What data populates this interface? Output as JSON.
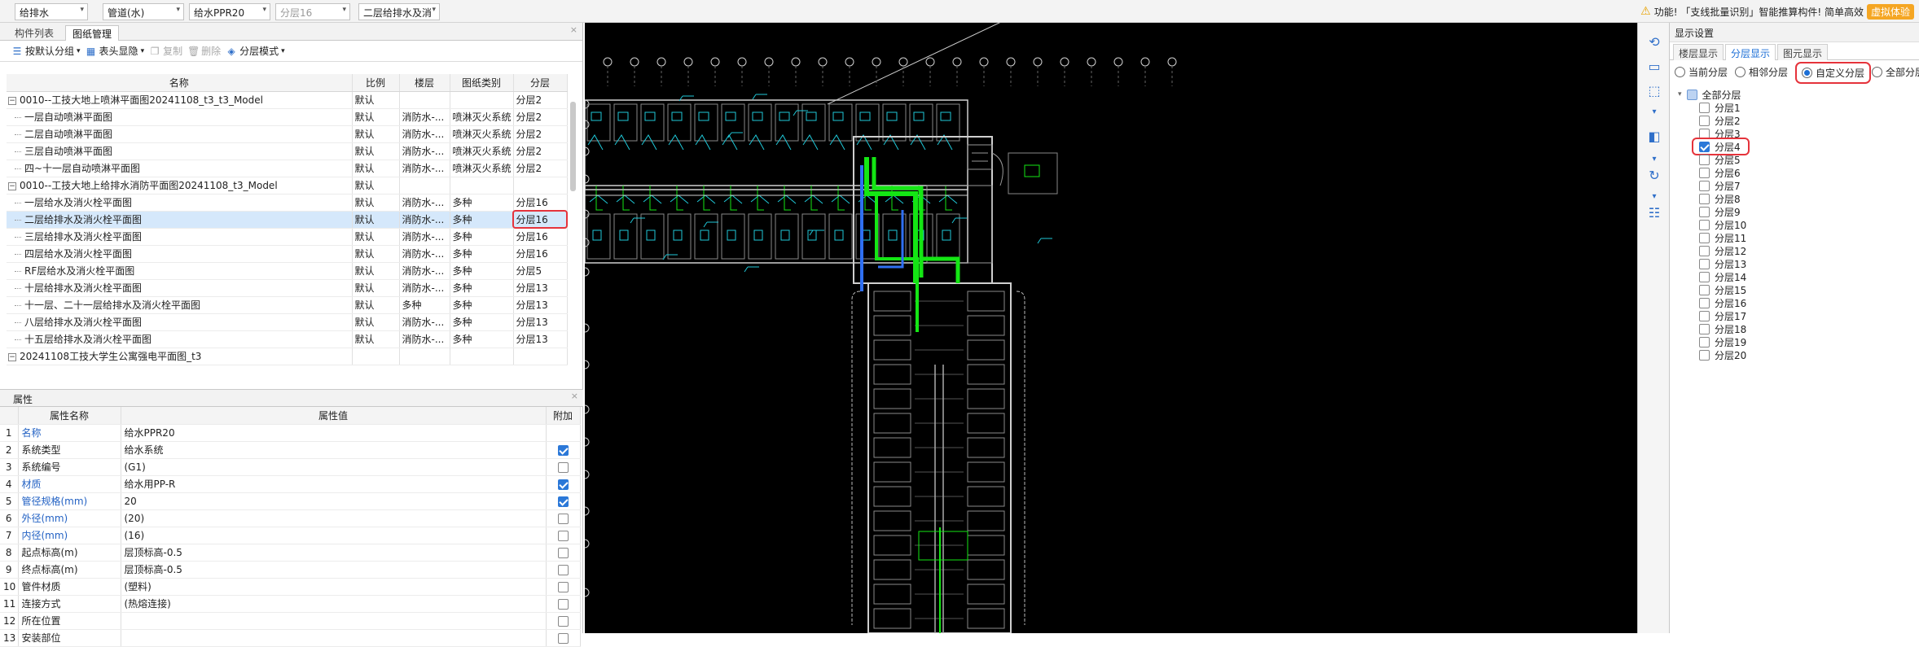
{
  "topbar": {
    "dropdowns": [
      {
        "label": "给排水"
      },
      {
        "label": "管道(水)"
      },
      {
        "label": "给水PPR20"
      },
      {
        "label": "分层16"
      },
      {
        "label": "二层给排水及消"
      }
    ],
    "notice": "功能! 「支线批量识别」智能推算构件! 简单高效",
    "notice_tag": "虚拟体验"
  },
  "left_tabs": [
    "构件列表",
    "图纸管理"
  ],
  "toolbar": {
    "group": "按默认分组",
    "header": "表头显隐",
    "copy": "复制",
    "delete": "删除",
    "layer_mode": "分层模式"
  },
  "drawing_table": {
    "headers": [
      "名称",
      "比例",
      "楼层",
      "图纸类别",
      "分层"
    ],
    "rows": [
      {
        "name": "0010--工技大地上喷淋平面图20241108_t3_t3_Model",
        "scale": "默认",
        "floor": "",
        "type": "",
        "layer": "分层2",
        "level": 0,
        "toggle": "−"
      },
      {
        "name": "一层自动喷淋平面图",
        "scale": "默认",
        "floor": "消防水-...",
        "type": "喷淋灭火系统",
        "layer": "分层2",
        "level": 1
      },
      {
        "name": "二层自动喷淋平面图",
        "scale": "默认",
        "floor": "消防水-...",
        "type": "喷淋灭火系统",
        "layer": "分层2",
        "level": 1
      },
      {
        "name": "三层自动喷淋平面图",
        "scale": "默认",
        "floor": "消防水-...",
        "type": "喷淋灭火系统",
        "layer": "分层2",
        "level": 1
      },
      {
        "name": "四~十一层自动喷淋平面图",
        "scale": "默认",
        "floor": "消防水-...",
        "type": "喷淋灭火系统",
        "layer": "分层2",
        "level": 1
      },
      {
        "name": "0010--工技大地上给排水消防平面图20241108_t3_Model",
        "scale": "默认",
        "floor": "",
        "type": "",
        "layer": "",
        "level": 0,
        "toggle": "−"
      },
      {
        "name": "一层给水及消火栓平面图",
        "scale": "默认",
        "floor": "消防水-...",
        "type": "多种",
        "layer": "分层16",
        "level": 1
      },
      {
        "name": "二层给排水及消火栓平面图",
        "scale": "默认",
        "floor": "消防水-...",
        "type": "多种",
        "layer": "分层16",
        "level": 1,
        "selected": true
      },
      {
        "name": "三层给排水及消火栓平面图",
        "scale": "默认",
        "floor": "消防水-...",
        "type": "多种",
        "layer": "分层16",
        "level": 1
      },
      {
        "name": "四层给水及消火栓平面图",
        "scale": "默认",
        "floor": "消防水-...",
        "type": "多种",
        "layer": "分层16",
        "level": 1
      },
      {
        "name": "RF层给水及消火栓平面图",
        "scale": "默认",
        "floor": "消防水-...",
        "type": "多种",
        "layer": "分层5",
        "level": 1
      },
      {
        "name": "十层给排水及消火栓平面图",
        "scale": "默认",
        "floor": "消防水-...",
        "type": "多种",
        "layer": "分层13",
        "level": 1
      },
      {
        "name": "十一层、二十一层给排水及消火栓平面图",
        "scale": "默认",
        "floor": "多种",
        "type": "多种",
        "layer": "分层13",
        "level": 1
      },
      {
        "name": "八层给排水及消火栓平面图",
        "scale": "默认",
        "floor": "消防水-...",
        "type": "多种",
        "layer": "分层13",
        "level": 1
      },
      {
        "name": "十五层给排水及消火栓平面图",
        "scale": "默认",
        "floor": "消防水-...",
        "type": "多种",
        "layer": "分层13",
        "level": 1
      },
      {
        "name": "20241108工技大学生公寓强电平面图_t3",
        "scale": "",
        "floor": "",
        "type": "",
        "layer": "",
        "level": 0,
        "toggle": "−"
      }
    ]
  },
  "properties": {
    "title": "属性",
    "headers": [
      "属性名称",
      "属性值",
      "附加"
    ],
    "rows": [
      {
        "n": "1",
        "name": "名称",
        "value": "给水PPR20",
        "blue": true,
        "check": null
      },
      {
        "n": "2",
        "name": "系统类型",
        "value": "给水系统",
        "blue": false,
        "check": true
      },
      {
        "n": "3",
        "name": "系统编号",
        "value": "(G1)",
        "blue": false,
        "check": false
      },
      {
        "n": "4",
        "name": "材质",
        "value": "给水用PP-R",
        "blue": true,
        "check": true
      },
      {
        "n": "5",
        "name": "管径规格(mm)",
        "value": "20",
        "blue": true,
        "check": true
      },
      {
        "n": "6",
        "name": "外径(mm)",
        "value": "(20)",
        "blue": true,
        "check": false
      },
      {
        "n": "7",
        "name": "内径(mm)",
        "value": "(16)",
        "blue": true,
        "check": false
      },
      {
        "n": "8",
        "name": "起点标高(m)",
        "value": "层顶标高-0.5",
        "blue": false,
        "check": false
      },
      {
        "n": "9",
        "name": "终点标高(m)",
        "value": "层顶标高-0.5",
        "blue": false,
        "check": false
      },
      {
        "n": "10",
        "name": "管件材质",
        "value": "(塑料)",
        "blue": false,
        "check": false
      },
      {
        "n": "11",
        "name": "连接方式",
        "value": "(热熔连接)",
        "blue": false,
        "check": false
      },
      {
        "n": "12",
        "name": "所在位置",
        "value": "",
        "blue": false,
        "check": false
      },
      {
        "n": "13",
        "name": "安装部位",
        "value": "",
        "blue": false,
        "check": false
      }
    ]
  },
  "display_settings": {
    "title": "显示设置",
    "tabs": [
      "楼层显示",
      "分层显示",
      "图元显示"
    ],
    "radios": [
      "当前分层",
      "相邻分层",
      "自定义分层",
      "全部分层"
    ],
    "tree_root": "全部分层",
    "layers": [
      "分层1",
      "分层2",
      "分层3",
      "分层4",
      "分层5",
      "分层6",
      "分层7",
      "分层8",
      "分层9",
      "分层10",
      "分层11",
      "分层12",
      "分层13",
      "分层14",
      "分层15",
      "分层16",
      "分层17",
      "分层18",
      "分层19",
      "分层20"
    ],
    "checked_layer": "分层4"
  },
  "colors": {
    "accent": "#1d6fd6",
    "highlight": "#e5333b",
    "cad_green": "#14e614",
    "cad_cyan": "#1fc8d8",
    "cad_blue": "#2f6ff2",
    "cad_white": "#cfcfcf"
  }
}
